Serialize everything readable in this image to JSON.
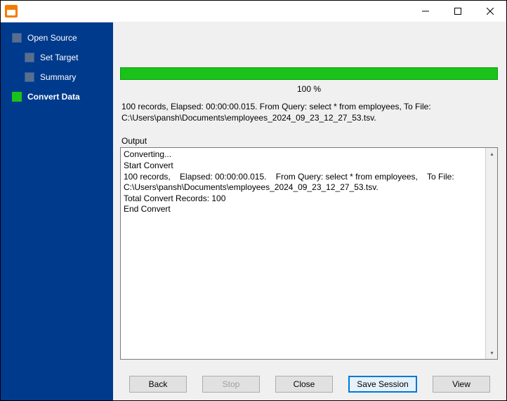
{
  "window": {
    "title": ""
  },
  "sidebar": {
    "items": [
      {
        "label": "Open Source",
        "active": false
      },
      {
        "label": "Set Target",
        "active": false
      },
      {
        "label": "Summary",
        "active": false
      },
      {
        "label": "Convert Data",
        "active": true
      }
    ]
  },
  "progress": {
    "percent_text": "100 %"
  },
  "status": {
    "line1": "100 records,    Elapsed: 00:00:00.015.    From Query: select * from employees,    To File:",
    "line2": "C:\\Users\\pansh\\Documents\\employees_2024_09_23_12_27_53.tsv."
  },
  "output": {
    "label": "Output",
    "text": "Converting...\nStart Convert\n100 records,    Elapsed: 00:00:00.015.    From Query: select * from employees,    To File: C:\\Users\\pansh\\Documents\\employees_2024_09_23_12_27_53.tsv.\nTotal Convert Records: 100\nEnd Convert"
  },
  "buttons": {
    "back": "Back",
    "stop": "Stop",
    "close": "Close",
    "save_session": "Save Session",
    "view": "View"
  }
}
